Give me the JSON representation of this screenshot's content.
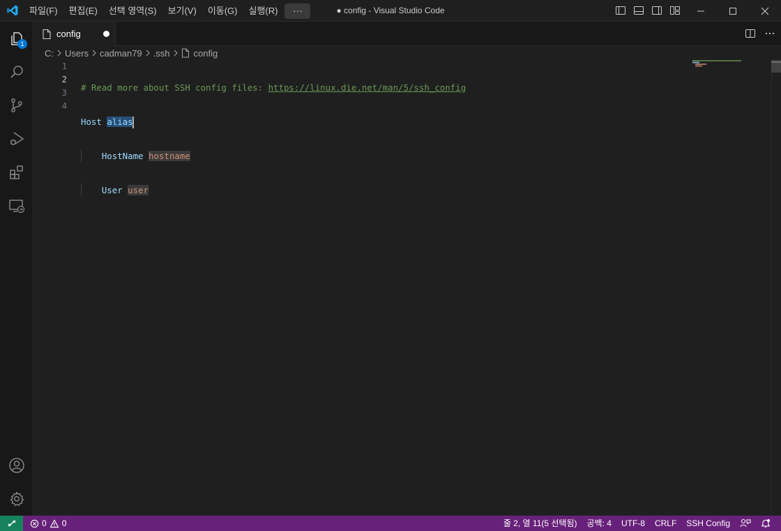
{
  "titlebar": {
    "menu": [
      "파일(F)",
      "편집(E)",
      "선택 영역(S)",
      "보기(V)",
      "이동(G)",
      "실행(R)"
    ],
    "more_label": "···",
    "window_title": "● config - Visual Studio Code"
  },
  "activitybar": {
    "explorer_badge": "1"
  },
  "tab": {
    "label": "config"
  },
  "breadcrumb": {
    "parts": [
      "C:",
      "Users",
      "cadman79",
      ".ssh",
      "config"
    ]
  },
  "editor": {
    "line_numbers": [
      "1",
      "2",
      "3",
      "4"
    ],
    "active_line": 2,
    "lines": [
      {
        "comment": "# Read more about SSH config files: ",
        "link": "https://linux.die.net/man/5/ssh_config"
      },
      {
        "keyword": "Host",
        "value": "alias"
      },
      {
        "indent": "    ",
        "keyword": "HostName",
        "value": "hostname"
      },
      {
        "indent": "    ",
        "keyword": "User",
        "value": "user"
      }
    ]
  },
  "statusbar": {
    "errors": "0",
    "warnings": "0",
    "position": "줄 2, 열 11(5 선택됨)",
    "indentation": "공백: 4",
    "encoding": "UTF-8",
    "eol": "CRLF",
    "language": "SSH Config"
  },
  "colors": {
    "statusbar_bg": "#68217a",
    "remote_bg": "#16825d",
    "accent": "#0078d4"
  }
}
